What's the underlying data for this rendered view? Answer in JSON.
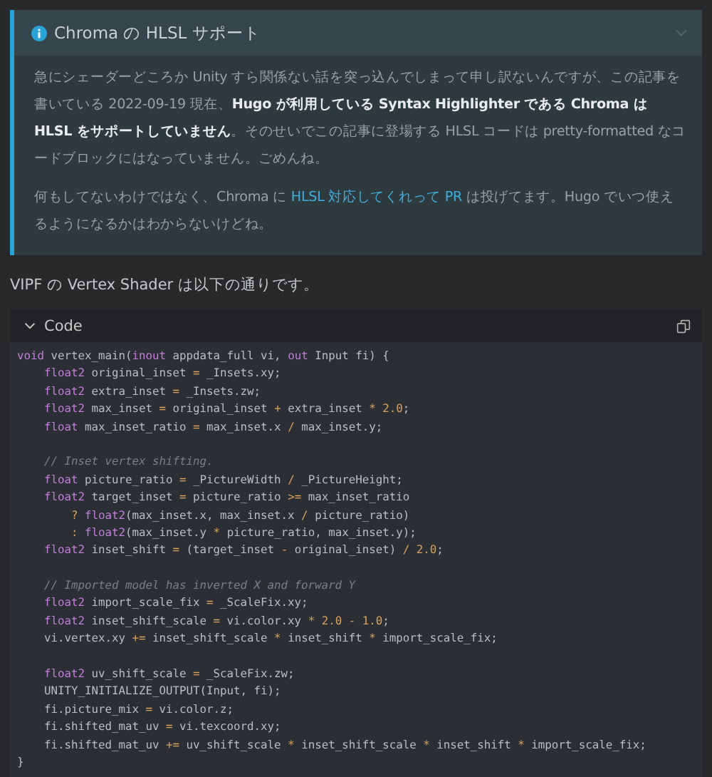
{
  "callout": {
    "title": "Chroma の HLSL サポート",
    "expanded": true,
    "paragraph_1": "急にシェーダーどころか Unity すら関係ない話を突っ込んでしまって申し訳ないんですが、この記事を書いている 2022-09-19 現在、**Hugo が利用している Syntax Highlighter である Chroma は HLSL をサポートしていません**。そのせいでこの記事に登場する HLSL コードは pretty-formatted なコードブロックにはなっていません。ごめんね。",
    "paragraph_2": {
      "before": "何もしてないわけではなく、Chroma に ",
      "link": "HLSL 対応してくれって PR",
      "after": " は投げてます。Hugo でいつ使えるようになるかはわからないけどね。"
    }
  },
  "intro": "VIPF の Vertex Shader は以下の通りです。",
  "code_block": {
    "title": "Code",
    "expanded": true,
    "lines": [
      {
        "gap_before": false,
        "tokens": [
          {
            "kind": "keyword",
            "text": "void"
          },
          {
            "kind": "plain",
            "text": " vertex_main("
          },
          {
            "kind": "keyword",
            "text": "inout"
          },
          {
            "kind": "plain",
            "text": " appdata_full vi, "
          },
          {
            "kind": "keyword",
            "text": "out"
          },
          {
            "kind": "plain",
            "text": " Input fi) {"
          }
        ]
      },
      {
        "gap_before": false,
        "tokens": [
          {
            "kind": "keyword",
            "text": "    float2"
          },
          {
            "kind": "plain",
            "text": " original_inset "
          },
          {
            "kind": "operator",
            "text": "="
          },
          {
            "kind": "plain",
            "text": " _Insets.xy;"
          }
        ]
      },
      {
        "gap_before": false,
        "tokens": [
          {
            "kind": "keyword",
            "text": "    float2"
          },
          {
            "kind": "plain",
            "text": " extra_inset "
          },
          {
            "kind": "operator",
            "text": "="
          },
          {
            "kind": "plain",
            "text": " _Insets.zw;"
          }
        ]
      },
      {
        "gap_before": false,
        "tokens": [
          {
            "kind": "keyword",
            "text": "    float2"
          },
          {
            "kind": "plain",
            "text": " max_inset "
          },
          {
            "kind": "operator",
            "text": "="
          },
          {
            "kind": "plain",
            "text": " original_inset "
          },
          {
            "kind": "operator",
            "text": "+"
          },
          {
            "kind": "plain",
            "text": " extra_inset "
          },
          {
            "kind": "operator",
            "text": "* "
          },
          {
            "kind": "number",
            "text": "2.0"
          },
          {
            "kind": "plain",
            "text": ";"
          }
        ]
      },
      {
        "gap_before": false,
        "tokens": [
          {
            "kind": "keyword",
            "text": "    float"
          },
          {
            "kind": "plain",
            "text": " max_inset_ratio "
          },
          {
            "kind": "operator",
            "text": "="
          },
          {
            "kind": "plain",
            "text": " max_inset.x "
          },
          {
            "kind": "operator",
            "text": "/"
          },
          {
            "kind": "plain",
            "text": " max_inset.y;"
          }
        ]
      },
      {
        "gap_before": true,
        "tokens": [
          {
            "kind": "comment",
            "text": "    // Inset vertex shifting."
          }
        ]
      },
      {
        "gap_before": false,
        "tokens": [
          {
            "kind": "keyword",
            "text": "    float"
          },
          {
            "kind": "plain",
            "text": " picture_ratio "
          },
          {
            "kind": "operator",
            "text": "="
          },
          {
            "kind": "plain",
            "text": " _PictureWidth "
          },
          {
            "kind": "operator",
            "text": "/"
          },
          {
            "kind": "plain",
            "text": " _PictureHeight;"
          }
        ]
      },
      {
        "gap_before": false,
        "tokens": [
          {
            "kind": "keyword",
            "text": "    float2"
          },
          {
            "kind": "plain",
            "text": " target_inset "
          },
          {
            "kind": "operator",
            "text": "="
          },
          {
            "kind": "plain",
            "text": " picture_ratio "
          },
          {
            "kind": "operator",
            "text": ">="
          },
          {
            "kind": "plain",
            "text": " max_inset_ratio"
          }
        ]
      },
      {
        "gap_before": false,
        "tokens": [
          {
            "kind": "operator",
            "text": "        ? "
          },
          {
            "kind": "keyword",
            "text": "float2"
          },
          {
            "kind": "plain",
            "text": "(max_inset.x, max_inset.x "
          },
          {
            "kind": "operator",
            "text": "/"
          },
          {
            "kind": "plain",
            "text": " picture_ratio)"
          }
        ]
      },
      {
        "gap_before": false,
        "tokens": [
          {
            "kind": "operator",
            "text": "        : "
          },
          {
            "kind": "keyword",
            "text": "float2"
          },
          {
            "kind": "plain",
            "text": "(max_inset.y "
          },
          {
            "kind": "operator",
            "text": "*"
          },
          {
            "kind": "plain",
            "text": " picture_ratio, max_inset.y);"
          }
        ]
      },
      {
        "gap_before": false,
        "tokens": [
          {
            "kind": "keyword",
            "text": "    float2"
          },
          {
            "kind": "plain",
            "text": " inset_shift "
          },
          {
            "kind": "operator",
            "text": "="
          },
          {
            "kind": "plain",
            "text": " (target_inset "
          },
          {
            "kind": "operator",
            "text": "-"
          },
          {
            "kind": "plain",
            "text": " original_inset) "
          },
          {
            "kind": "operator",
            "text": "/ "
          },
          {
            "kind": "number",
            "text": "2.0"
          },
          {
            "kind": "plain",
            "text": ";"
          }
        ]
      },
      {
        "gap_before": true,
        "tokens": [
          {
            "kind": "comment",
            "text": "    // Imported model has inverted X and forward Y"
          }
        ]
      },
      {
        "gap_before": false,
        "tokens": [
          {
            "kind": "keyword",
            "text": "    float2"
          },
          {
            "kind": "plain",
            "text": " import_scale_fix "
          },
          {
            "kind": "operator",
            "text": "="
          },
          {
            "kind": "plain",
            "text": " _ScaleFix.xy;"
          }
        ]
      },
      {
        "gap_before": false,
        "tokens": [
          {
            "kind": "keyword",
            "text": "    float2"
          },
          {
            "kind": "plain",
            "text": " inset_shift_scale "
          },
          {
            "kind": "operator",
            "text": "="
          },
          {
            "kind": "plain",
            "text": " vi.color.xy "
          },
          {
            "kind": "operator",
            "text": "* "
          },
          {
            "kind": "number",
            "text": "2.0"
          },
          {
            "kind": "operator",
            "text": " - "
          },
          {
            "kind": "number",
            "text": "1.0"
          },
          {
            "kind": "plain",
            "text": ";"
          }
        ]
      },
      {
        "gap_before": false,
        "tokens": [
          {
            "kind": "plain",
            "text": "    vi.vertex.xy "
          },
          {
            "kind": "operator",
            "text": "+="
          },
          {
            "kind": "plain",
            "text": " inset_shift_scale "
          },
          {
            "kind": "operator",
            "text": "*"
          },
          {
            "kind": "plain",
            "text": " inset_shift "
          },
          {
            "kind": "operator",
            "text": "*"
          },
          {
            "kind": "plain",
            "text": " import_scale_fix;"
          }
        ]
      },
      {
        "gap_before": true,
        "tokens": [
          {
            "kind": "keyword",
            "text": "    float2"
          },
          {
            "kind": "plain",
            "text": " uv_shift_scale "
          },
          {
            "kind": "operator",
            "text": "="
          },
          {
            "kind": "plain",
            "text": " _ScaleFix.zw;"
          }
        ]
      },
      {
        "gap_before": false,
        "tokens": [
          {
            "kind": "plain",
            "text": "    UNITY_INITIALIZE_OUTPUT(Input, fi);"
          }
        ]
      },
      {
        "gap_before": false,
        "tokens": [
          {
            "kind": "plain",
            "text": "    fi.picture_mix "
          },
          {
            "kind": "operator",
            "text": "="
          },
          {
            "kind": "plain",
            "text": " vi.color.z;"
          }
        ]
      },
      {
        "gap_before": false,
        "tokens": [
          {
            "kind": "plain",
            "text": "    fi.shifted_mat_uv "
          },
          {
            "kind": "operator",
            "text": "="
          },
          {
            "kind": "plain",
            "text": " vi.texcoord.xy;"
          }
        ]
      },
      {
        "gap_before": false,
        "tokens": [
          {
            "kind": "plain",
            "text": "    fi.shifted_mat_uv "
          },
          {
            "kind": "operator",
            "text": "+="
          },
          {
            "kind": "plain",
            "text": " uv_shift_scale "
          },
          {
            "kind": "operator",
            "text": "*"
          },
          {
            "kind": "plain",
            "text": " inset_shift_scale "
          },
          {
            "kind": "operator",
            "text": "*"
          },
          {
            "kind": "plain",
            "text": " inset_shift "
          },
          {
            "kind": "operator",
            "text": "*"
          },
          {
            "kind": "plain",
            "text": " import_scale_fix;"
          }
        ]
      },
      {
        "gap_before": false,
        "tokens": [
          {
            "kind": "plain",
            "text": "}"
          }
        ]
      }
    ]
  }
}
